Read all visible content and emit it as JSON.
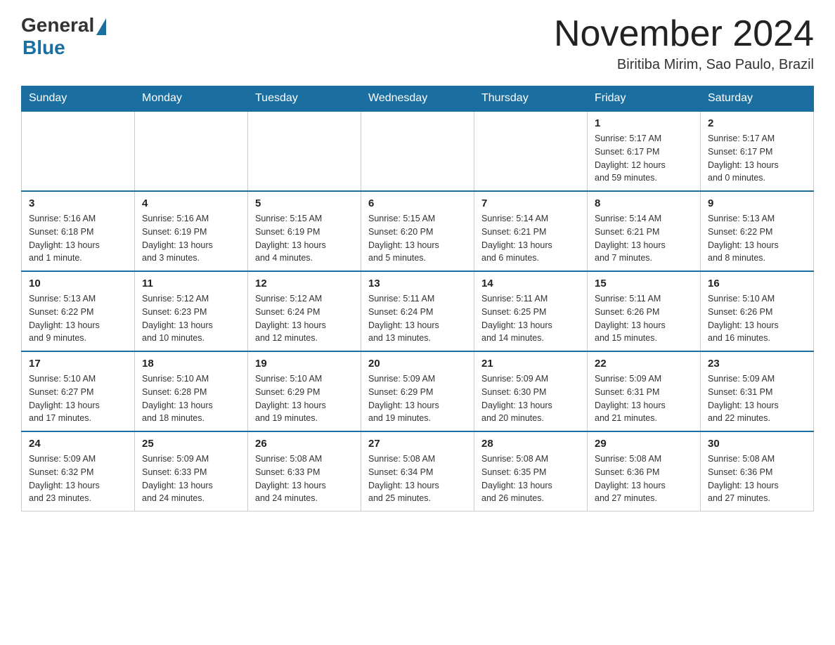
{
  "header": {
    "logo_general": "General",
    "logo_blue": "Blue",
    "month_title": "November 2024",
    "location": "Biritiba Mirim, Sao Paulo, Brazil"
  },
  "weekdays": [
    "Sunday",
    "Monday",
    "Tuesday",
    "Wednesday",
    "Thursday",
    "Friday",
    "Saturday"
  ],
  "weeks": [
    [
      {
        "day": "",
        "info": ""
      },
      {
        "day": "",
        "info": ""
      },
      {
        "day": "",
        "info": ""
      },
      {
        "day": "",
        "info": ""
      },
      {
        "day": "",
        "info": ""
      },
      {
        "day": "1",
        "info": "Sunrise: 5:17 AM\nSunset: 6:17 PM\nDaylight: 12 hours\nand 59 minutes."
      },
      {
        "day": "2",
        "info": "Sunrise: 5:17 AM\nSunset: 6:17 PM\nDaylight: 13 hours\nand 0 minutes."
      }
    ],
    [
      {
        "day": "3",
        "info": "Sunrise: 5:16 AM\nSunset: 6:18 PM\nDaylight: 13 hours\nand 1 minute."
      },
      {
        "day": "4",
        "info": "Sunrise: 5:16 AM\nSunset: 6:19 PM\nDaylight: 13 hours\nand 3 minutes."
      },
      {
        "day": "5",
        "info": "Sunrise: 5:15 AM\nSunset: 6:19 PM\nDaylight: 13 hours\nand 4 minutes."
      },
      {
        "day": "6",
        "info": "Sunrise: 5:15 AM\nSunset: 6:20 PM\nDaylight: 13 hours\nand 5 minutes."
      },
      {
        "day": "7",
        "info": "Sunrise: 5:14 AM\nSunset: 6:21 PM\nDaylight: 13 hours\nand 6 minutes."
      },
      {
        "day": "8",
        "info": "Sunrise: 5:14 AM\nSunset: 6:21 PM\nDaylight: 13 hours\nand 7 minutes."
      },
      {
        "day": "9",
        "info": "Sunrise: 5:13 AM\nSunset: 6:22 PM\nDaylight: 13 hours\nand 8 minutes."
      }
    ],
    [
      {
        "day": "10",
        "info": "Sunrise: 5:13 AM\nSunset: 6:22 PM\nDaylight: 13 hours\nand 9 minutes."
      },
      {
        "day": "11",
        "info": "Sunrise: 5:12 AM\nSunset: 6:23 PM\nDaylight: 13 hours\nand 10 minutes."
      },
      {
        "day": "12",
        "info": "Sunrise: 5:12 AM\nSunset: 6:24 PM\nDaylight: 13 hours\nand 12 minutes."
      },
      {
        "day": "13",
        "info": "Sunrise: 5:11 AM\nSunset: 6:24 PM\nDaylight: 13 hours\nand 13 minutes."
      },
      {
        "day": "14",
        "info": "Sunrise: 5:11 AM\nSunset: 6:25 PM\nDaylight: 13 hours\nand 14 minutes."
      },
      {
        "day": "15",
        "info": "Sunrise: 5:11 AM\nSunset: 6:26 PM\nDaylight: 13 hours\nand 15 minutes."
      },
      {
        "day": "16",
        "info": "Sunrise: 5:10 AM\nSunset: 6:26 PM\nDaylight: 13 hours\nand 16 minutes."
      }
    ],
    [
      {
        "day": "17",
        "info": "Sunrise: 5:10 AM\nSunset: 6:27 PM\nDaylight: 13 hours\nand 17 minutes."
      },
      {
        "day": "18",
        "info": "Sunrise: 5:10 AM\nSunset: 6:28 PM\nDaylight: 13 hours\nand 18 minutes."
      },
      {
        "day": "19",
        "info": "Sunrise: 5:10 AM\nSunset: 6:29 PM\nDaylight: 13 hours\nand 19 minutes."
      },
      {
        "day": "20",
        "info": "Sunrise: 5:09 AM\nSunset: 6:29 PM\nDaylight: 13 hours\nand 19 minutes."
      },
      {
        "day": "21",
        "info": "Sunrise: 5:09 AM\nSunset: 6:30 PM\nDaylight: 13 hours\nand 20 minutes."
      },
      {
        "day": "22",
        "info": "Sunrise: 5:09 AM\nSunset: 6:31 PM\nDaylight: 13 hours\nand 21 minutes."
      },
      {
        "day": "23",
        "info": "Sunrise: 5:09 AM\nSunset: 6:31 PM\nDaylight: 13 hours\nand 22 minutes."
      }
    ],
    [
      {
        "day": "24",
        "info": "Sunrise: 5:09 AM\nSunset: 6:32 PM\nDaylight: 13 hours\nand 23 minutes."
      },
      {
        "day": "25",
        "info": "Sunrise: 5:09 AM\nSunset: 6:33 PM\nDaylight: 13 hours\nand 24 minutes."
      },
      {
        "day": "26",
        "info": "Sunrise: 5:08 AM\nSunset: 6:33 PM\nDaylight: 13 hours\nand 24 minutes."
      },
      {
        "day": "27",
        "info": "Sunrise: 5:08 AM\nSunset: 6:34 PM\nDaylight: 13 hours\nand 25 minutes."
      },
      {
        "day": "28",
        "info": "Sunrise: 5:08 AM\nSunset: 6:35 PM\nDaylight: 13 hours\nand 26 minutes."
      },
      {
        "day": "29",
        "info": "Sunrise: 5:08 AM\nSunset: 6:36 PM\nDaylight: 13 hours\nand 27 minutes."
      },
      {
        "day": "30",
        "info": "Sunrise: 5:08 AM\nSunset: 6:36 PM\nDaylight: 13 hours\nand 27 minutes."
      }
    ]
  ]
}
